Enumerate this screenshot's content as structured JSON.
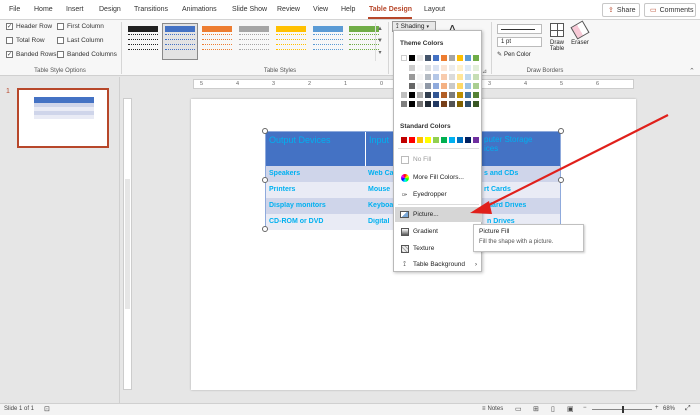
{
  "tabs": [
    "File",
    "Home",
    "Insert",
    "Design",
    "Transitions",
    "Animations",
    "Slide Show",
    "Review",
    "View",
    "Help",
    "Table Design",
    "Layout"
  ],
  "active_tab": "Table Design",
  "top_buttons": {
    "share": "Share",
    "comments": "Comments"
  },
  "style_options": {
    "items": [
      {
        "label": "Header Row",
        "checked": true
      },
      {
        "label": "First Column",
        "checked": false
      },
      {
        "label": "Total Row",
        "checked": false
      },
      {
        "label": "Last Column",
        "checked": false
      },
      {
        "label": "Banded Rows",
        "checked": true
      },
      {
        "label": "Banded Columns",
        "checked": false
      }
    ],
    "group_label": "Table Style Options"
  },
  "table_styles": {
    "group_label": "Table Styles",
    "colors": [
      "#222222",
      "#4472c4",
      "#ed7d31",
      "#a5a5a5",
      "#ffc000",
      "#5b9bd5",
      "#70ad47"
    ]
  },
  "shading": {
    "label": "Shading"
  },
  "draw_borders": {
    "pen_weight": "1 pt",
    "pen_color": "Pen Color",
    "draw_table": "Draw Table",
    "eraser": "Eraser",
    "group_label": "Draw Borders"
  },
  "shading_menu": {
    "theme_colors_label": "Theme Colors",
    "theme_colors": [
      "#ffffff",
      "#000000",
      "#e7e6e6",
      "#44546a",
      "#4472c4",
      "#ed7d31",
      "#a5a5a5",
      "#ffc000",
      "#5b9bd5",
      "#70ad47"
    ],
    "standard_colors_label": "Standard Colors",
    "standard_colors": [
      "#c00000",
      "#ff0000",
      "#ffc000",
      "#ffff00",
      "#92d050",
      "#00b050",
      "#00b0f0",
      "#0070c0",
      "#002060",
      "#7030a0"
    ],
    "items": [
      {
        "label": "No Fill",
        "icon": "no-fill-icon",
        "enabled": false
      },
      {
        "label": "More Fill Colors...",
        "icon": "palette-icon",
        "enabled": true
      },
      {
        "label": "Eyedropper",
        "icon": "eyedropper-icon",
        "enabled": true
      },
      {
        "label": "Picture...",
        "icon": "picture-icon",
        "enabled": true
      },
      {
        "label": "Gradient",
        "icon": "gradient-icon",
        "enabled": true
      },
      {
        "label": "Texture",
        "icon": "texture-icon",
        "enabled": true
      },
      {
        "label": "Table Background",
        "icon": "paint-bucket-icon",
        "enabled": true
      }
    ],
    "highlighted": "Picture..."
  },
  "tooltip": {
    "title": "Picture Fill",
    "description": "Fill the shape with a picture."
  },
  "slide_panel": {
    "slide_number": "1"
  },
  "table": {
    "header": [
      "Output Devices",
      "Input",
      "puter Storage\nices"
    ],
    "rows": [
      [
        "Speakers",
        "Web Ca",
        "s and CDs"
      ],
      [
        "Printers",
        "Mouse",
        "rt Cards"
      ],
      [
        "Display monitors",
        "Keyboa",
        "Hard Drives"
      ],
      [
        "CD-ROM or DVD",
        "Digital",
        "n Drives"
      ]
    ],
    "header_color": "#4472c4",
    "band_color": "#cfd5ea",
    "alt_color": "#e9ebf5",
    "text_color": "#00b0f0"
  },
  "ruler_labels": [
    "5",
    "4",
    "3",
    "2",
    "1",
    "0",
    "1",
    "2",
    "3",
    "4",
    "5",
    "6"
  ],
  "status": {
    "slide_info": "Slide 1 of 1",
    "notes": "Notes",
    "zoom": "68%"
  },
  "accent_color": "#b7472a",
  "arrow_color": "#e0201b"
}
